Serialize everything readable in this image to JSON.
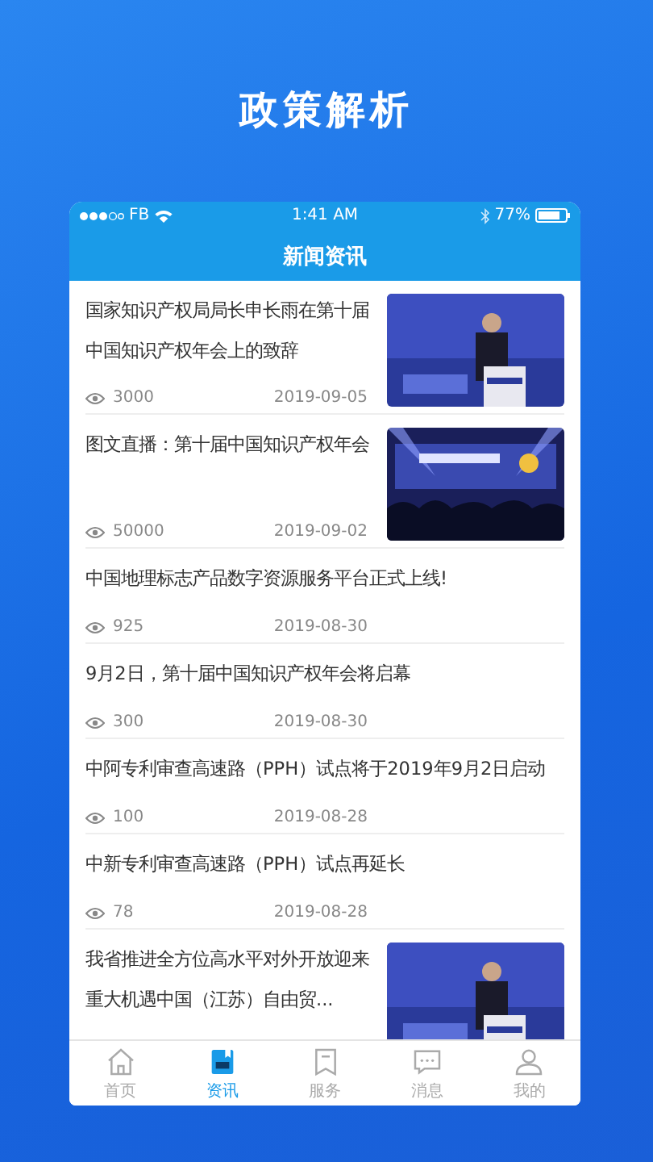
{
  "page_title": "政策解析",
  "status_bar": {
    "carrier": "FB",
    "time": "1:41 AM",
    "battery": "77%"
  },
  "nav_title": "新闻资讯",
  "news": [
    {
      "kind": "picture",
      "title": "国家知识产权局局长申长雨在第十届中国知识产权年会上的致辞",
      "views": "3000",
      "date": "2019-09-05"
    },
    {
      "kind": "picture",
      "title": "图文直播：第十届中国知识产权年会",
      "views": "50000",
      "date": "2019-09-02"
    },
    {
      "kind": "text",
      "title": "中国地理标志产品数字资源服务平台正式上线!",
      "views": "925",
      "date": "2019-08-30"
    },
    {
      "kind": "text",
      "title": "9月2日，第十届中国知识产权年会将启幕",
      "views": "300",
      "date": "2019-08-30"
    },
    {
      "kind": "text",
      "title": "中阿专利审查高速路（PPH）试点将于2019年9月2日启动",
      "views": "100",
      "date": "2019-08-28"
    },
    {
      "kind": "text",
      "title": "中新专利审查高速路（PPH）试点再延长",
      "views": "78",
      "date": "2019-08-28"
    },
    {
      "kind": "picture",
      "title": "我省推进全方位高水平对外开放迎来重大机遇中国（江苏）自由贸..."
    }
  ],
  "tabs": [
    {
      "label": "首页",
      "selected": false
    },
    {
      "label": "资讯",
      "selected": true
    },
    {
      "label": "服务",
      "selected": false
    },
    {
      "label": "消息",
      "selected": false
    },
    {
      "label": "我的",
      "selected": false
    }
  ]
}
